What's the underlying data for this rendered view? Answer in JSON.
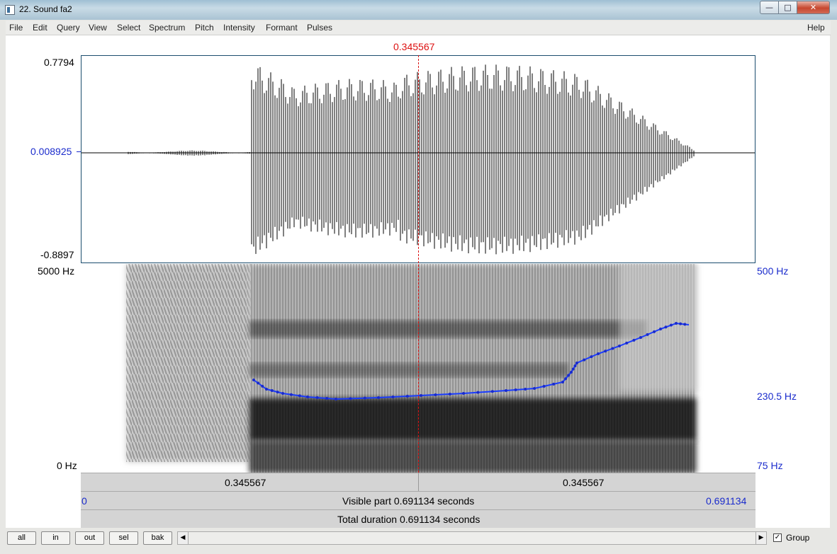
{
  "window": {
    "title": "22. Sound fa2",
    "icon": "praat-window-icon"
  },
  "caption_buttons": {
    "minimize": "—",
    "maximize": "□",
    "close": "✕"
  },
  "menu": {
    "items": [
      "File",
      "Edit",
      "Query",
      "View",
      "Select",
      "Spectrum",
      "Pitch",
      "Intensity",
      "Formant",
      "Pulses"
    ],
    "help": "Help"
  },
  "cursor": {
    "time_label": "0.345567",
    "color": "#d11111"
  },
  "waveform": {
    "max_label": "0.7794",
    "mid_label": "0.008925",
    "min_label": "-0.8897"
  },
  "spectrogram": {
    "top_label": "5000 Hz",
    "bottom_label": "0 Hz"
  },
  "pitch": {
    "top_label": "500 Hz",
    "mid_label": "230.5 Hz",
    "bottom_label": "75 Hz",
    "color": "#1a3cff"
  },
  "time_bars": {
    "left_segment": "0.345567",
    "right_segment": "0.345567",
    "visible_start": "0",
    "visible_text": "Visible part 0.691134 seconds",
    "visible_end": "0.691134",
    "total_text": "Total duration 0.691134 seconds"
  },
  "bottom": {
    "buttons": [
      "all",
      "in",
      "out",
      "sel",
      "bak"
    ],
    "group_label": "Group",
    "group_checked": "✓"
  }
}
